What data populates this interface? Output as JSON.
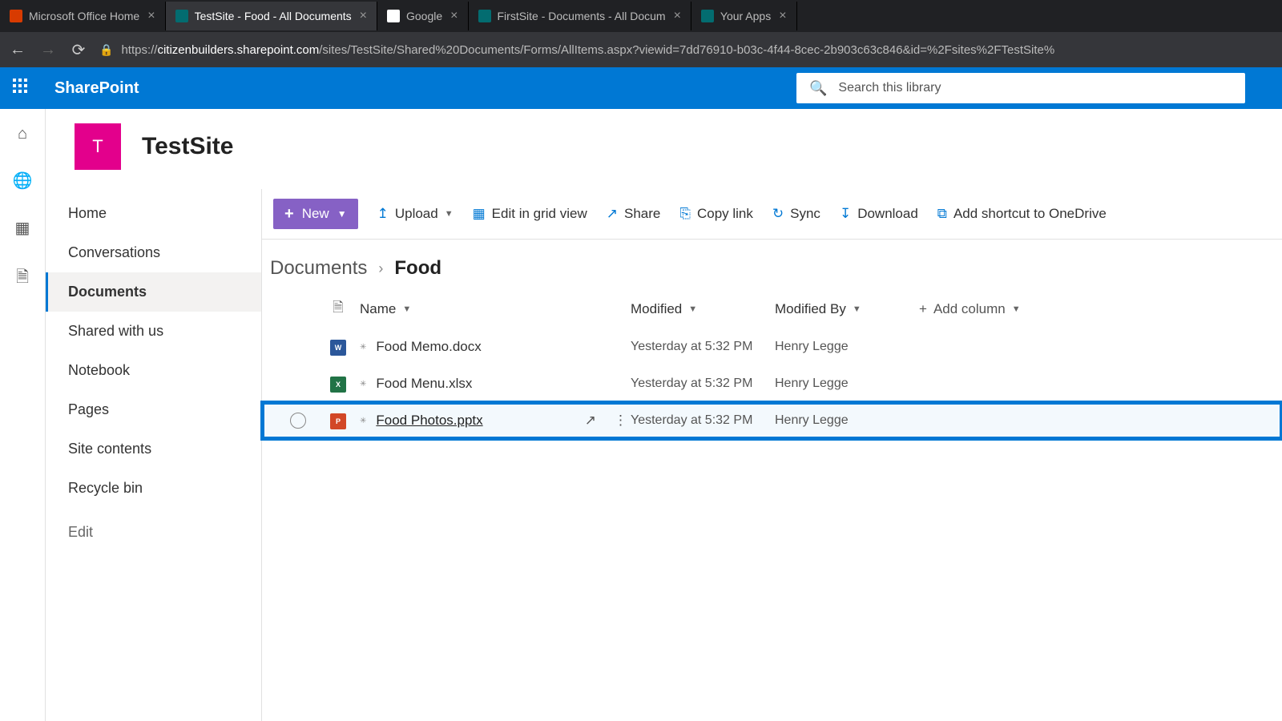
{
  "browser": {
    "tabs": [
      {
        "title": "Microsoft Office Home",
        "icon_bg": "#d83b01",
        "active": false
      },
      {
        "title": "TestSite - Food - All Documents",
        "icon_bg": "#036c70",
        "active": true
      },
      {
        "title": "Google",
        "icon_bg": "#ffffff",
        "active": false
      },
      {
        "title": "FirstSite - Documents - All Docum",
        "icon_bg": "#036c70",
        "active": false
      },
      {
        "title": "Your Apps",
        "icon_bg": "#036c70",
        "active": false
      }
    ],
    "url_host": "citizenbuilders.sharepoint.com",
    "url_path": "/sites/TestSite/Shared%20Documents/Forms/AllItems.aspx?viewid=7dd76910-b03c-4f44-8cec-2b903c63c846&id=%2Fsites%2FTestSite%"
  },
  "suite": {
    "product": "SharePoint",
    "search_placeholder": "Search this library"
  },
  "site": {
    "logo_letter": "T",
    "logo_bg": "#e3008c",
    "name": "TestSite"
  },
  "leftnav": {
    "items": [
      "Home",
      "Conversations",
      "Documents",
      "Shared with us",
      "Notebook",
      "Pages",
      "Site contents",
      "Recycle bin"
    ],
    "active_index": 2,
    "edit_label": "Edit"
  },
  "commandbar": {
    "new": "New",
    "upload": "Upload",
    "edit_grid": "Edit in grid view",
    "share": "Share",
    "copylink": "Copy link",
    "sync": "Sync",
    "download": "Download",
    "shortcut": "Add shortcut to OneDrive"
  },
  "breadcrumb": {
    "parent": "Documents",
    "current": "Food"
  },
  "columns": {
    "name": "Name",
    "modified": "Modified",
    "modified_by": "Modified By",
    "add": "Add column"
  },
  "files": [
    {
      "name": "Food Memo.docx",
      "type": "word",
      "modified": "Yesterday at 5:32 PM",
      "by": "Henry Legge",
      "highlight": false
    },
    {
      "name": "Food Menu.xlsx",
      "type": "excel",
      "modified": "Yesterday at 5:32 PM",
      "by": "Henry Legge",
      "highlight": false
    },
    {
      "name": "Food Photos.pptx",
      "type": "ppt",
      "modified": "Yesterday at 5:32 PM",
      "by": "Henry Legge",
      "highlight": true
    }
  ]
}
